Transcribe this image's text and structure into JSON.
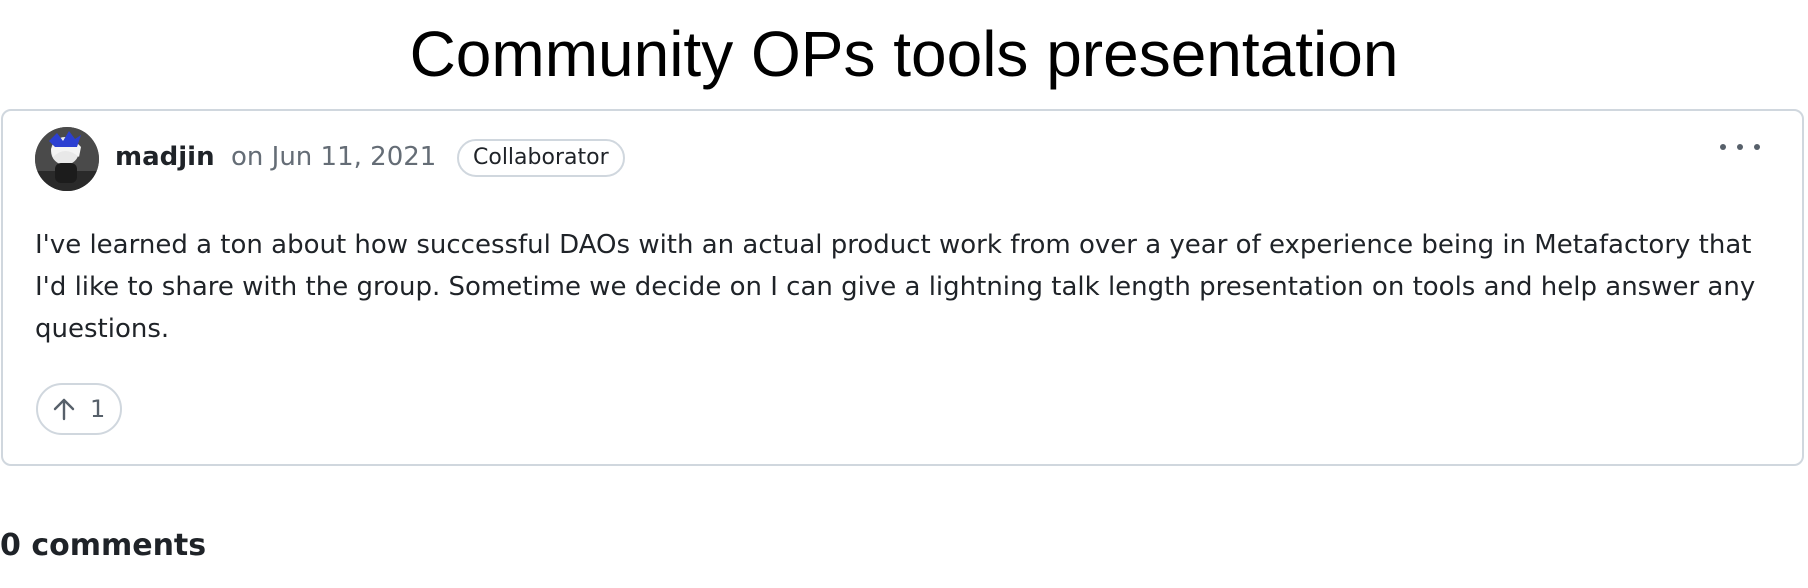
{
  "page": {
    "title": "Community OPs tools presentation"
  },
  "post": {
    "author": "madjin",
    "date": "on Jun 11, 2021",
    "role_badge": "Collaborator",
    "body": "I've learned a ton about how successful DAOs with an actual product work from over a year of experience being in Metafactory that I'd like to share with the group. Sometime we decide on I can give a lightning talk length presentation on tools and help answer any questions.",
    "upvotes": "1",
    "avatar_icon": "user-avatar",
    "more_icon": "kebab-horizontal-icon",
    "upvote_icon": "arrow-up-icon"
  },
  "comments": {
    "heading": "0 comments"
  },
  "colors": {
    "border": "#d0d7de",
    "text": "#1f2328",
    "muted": "#656d76"
  }
}
